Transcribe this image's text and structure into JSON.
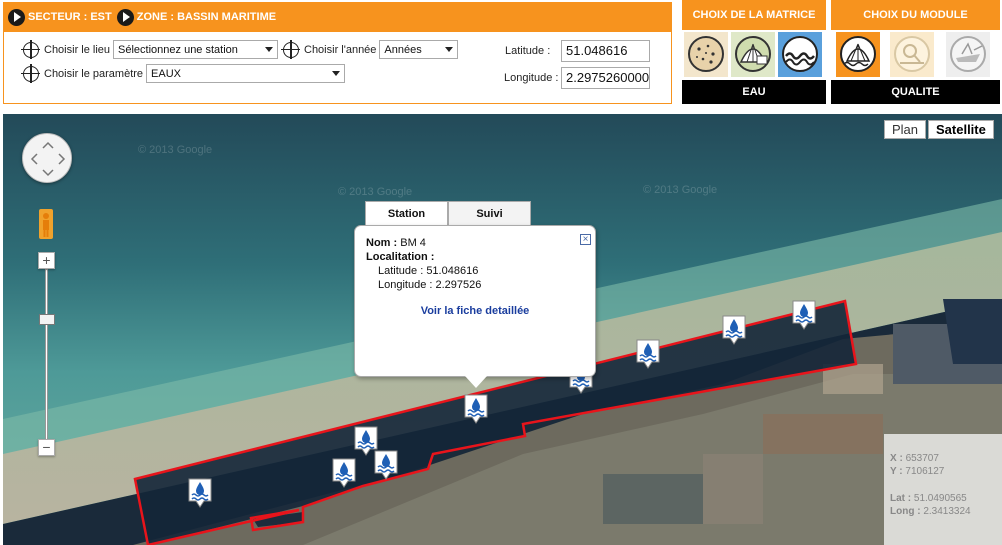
{
  "header": {
    "secteur_label": "SECTEUR : EST",
    "zone_label": "ZONE : BASSIN MARITIME"
  },
  "filters": {
    "lieu_label": "Choisir le lieu",
    "lieu_value": "Sélectionnez une station",
    "annee_label": "Choisir l'année",
    "annee_value": "Années",
    "parametre_label": "Choisir le paramètre",
    "parametre_value": "EAUX",
    "latitude_label": "Latitude :",
    "latitude_value": "51.048616",
    "longitude_label": "Longitude :",
    "longitude_value": "2.29752600000"
  },
  "matrice": {
    "title": "CHOIX DE LA MATRICE",
    "selected_label": "EAU",
    "icons": [
      "sediment-icon",
      "shell-icon",
      "water-wave-icon"
    ]
  },
  "module": {
    "title": "CHOIX DU MODULE",
    "selected_label": "QUALITE",
    "icons": [
      "quality-shell-icon",
      "analysis-icon",
      "vessel-icon"
    ]
  },
  "map": {
    "type_plan": "Plan",
    "type_satellite": "Satellite",
    "watermark": "© 2013 Google",
    "zoom_in": "+",
    "zoom_out": "−",
    "marker_icon": "water-station-marker-icon"
  },
  "infowindow": {
    "tab_station": "Station",
    "tab_suivi": "Suivi",
    "nom_label": "Nom :",
    "nom_value": "BM 4",
    "localisation_label": "Localitation :",
    "latitude_text": "Latitude : 51.048616",
    "longitude_text": "Longitude : 2.297526",
    "link_text": "Voir la fiche detaillée",
    "close": "×"
  },
  "coords_box": {
    "x_label": "X :",
    "x_value": "653707",
    "y_label": "Y :",
    "y_value": "7106127",
    "lat_label": "Lat :",
    "lat_value": "51.0490565",
    "long_label": "Long :",
    "long_value": "2.3413324"
  },
  "colors": {
    "accent": "#f7931e",
    "selected_module": "#f7931e",
    "zone_outline": "#e8141b"
  }
}
